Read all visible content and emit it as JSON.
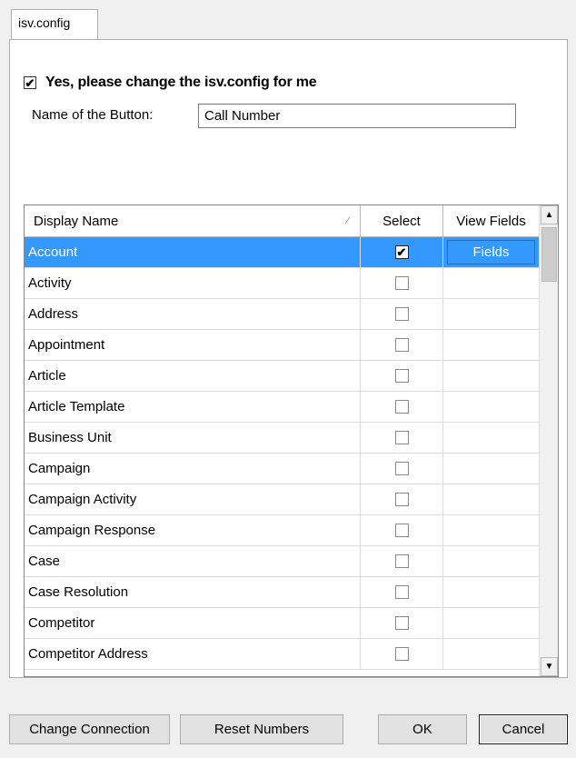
{
  "tab": {
    "label": "isv.config"
  },
  "change_config": {
    "checked_mark": "✔",
    "label": "Yes, please change the isv.config for me"
  },
  "button_name": {
    "label": "Name of the Button:",
    "value": "Call Number"
  },
  "grid": {
    "columns": [
      "Display Name",
      "Select",
      "View Fields"
    ],
    "sort_glyph": "⁄",
    "rows": [
      {
        "name": "Account",
        "selected": true,
        "fields_label": "Fields"
      },
      {
        "name": "Activity",
        "selected": false
      },
      {
        "name": "Address",
        "selected": false
      },
      {
        "name": "Appointment",
        "selected": false
      },
      {
        "name": "Article",
        "selected": false
      },
      {
        "name": "Article Template",
        "selected": false
      },
      {
        "name": "Business Unit",
        "selected": false
      },
      {
        "name": "Campaign",
        "selected": false
      },
      {
        "name": "Campaign Activity",
        "selected": false
      },
      {
        "name": "Campaign Response",
        "selected": false
      },
      {
        "name": "Case",
        "selected": false
      },
      {
        "name": "Case Resolution",
        "selected": false
      },
      {
        "name": "Competitor",
        "selected": false
      },
      {
        "name": "Competitor Address",
        "selected": false
      }
    ],
    "scroll_up_glyph": "▲",
    "scroll_down_glyph": "▼"
  },
  "buttons": {
    "change_connection": "Change Connection",
    "reset_numbers": "Reset Numbers",
    "ok": "OK",
    "cancel": "Cancel"
  },
  "colors": {
    "selection": "#3399ff",
    "background": "#f0f0f0"
  }
}
